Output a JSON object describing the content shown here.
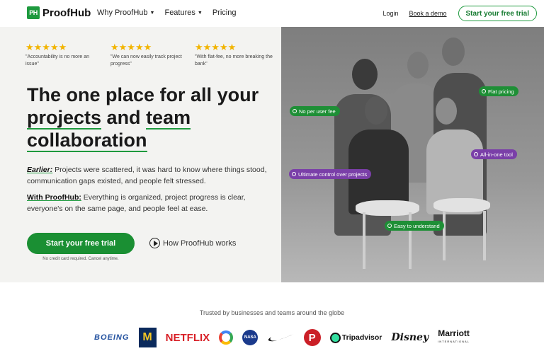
{
  "nav": {
    "logo_mark": "PH",
    "logo_text": "ProofHub",
    "links": [
      "Why ProofHub",
      "Features",
      "Pricing"
    ],
    "login": "Login",
    "demo": "Book a demo",
    "cta": "Start your free trial"
  },
  "testimonials": [
    {
      "stars": "★★★★★",
      "quote": "\"Accountability is no more an issue\""
    },
    {
      "stars": "★★★★★",
      "quote": "\"We can now easily track project progress\""
    },
    {
      "stars": "★★★★★",
      "quote": "\"With flat-fee, no more breaking the bank\""
    }
  ],
  "hero": {
    "headline_part1": "The one place for all your",
    "headline_projects": "projects",
    "headline_and": " and ",
    "headline_team": "team",
    "headline_collab": "collaboration",
    "earlier_label": "Earlier:",
    "earlier_text": " Projects were scattered, it was hard to know where things stood, communication gaps existed, and people felt stressed.",
    "with_label": "With ProofHub:",
    "with_text": " Everything is organized, project progress is clear, everyone's on the same page, and people feel at ease.",
    "cta": "Start your free trial",
    "cta_note": "No credit card required. Cancel anytime.",
    "how_link": "How ProofHub works"
  },
  "chips": {
    "flat_pricing": "Flat pricing",
    "no_per_user": "No per user fee",
    "all_in_one": "All-in-one tool",
    "ultimate_control": "Ultimate control over projects",
    "easy": "Easy to understand"
  },
  "trust": {
    "title": "Trusted by businesses and teams around the globe",
    "logos": {
      "boeing": "BOEING",
      "michigan": "M",
      "netflix": "NETFLIX",
      "nasa": "NASA",
      "pinterest": "P",
      "tripadvisor": "Tripadvisor",
      "disney": "Disney",
      "marriott": "Marriott",
      "marriott_sub": "INTERNATIONAL"
    }
  },
  "colors": {
    "brand_green": "#1e9a3e",
    "chip_purple": "#7a3fa8",
    "star": "#f2b400"
  }
}
